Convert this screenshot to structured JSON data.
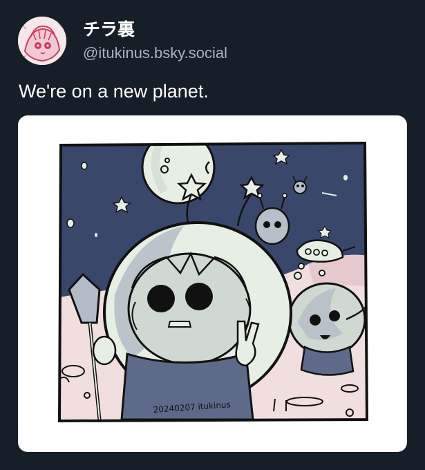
{
  "post": {
    "author": {
      "display_name": "チラ裏",
      "handle": "@itukinus.bsky.social",
      "avatar_icon": "avatar-illustration"
    },
    "text": "We're on a new planet.",
    "image": {
      "signature": "20240207 itukinus",
      "background": "#ffffff",
      "sky_color": "#38476a",
      "ground_color": "#f1dede",
      "moon_color": "#e7efe5"
    }
  }
}
